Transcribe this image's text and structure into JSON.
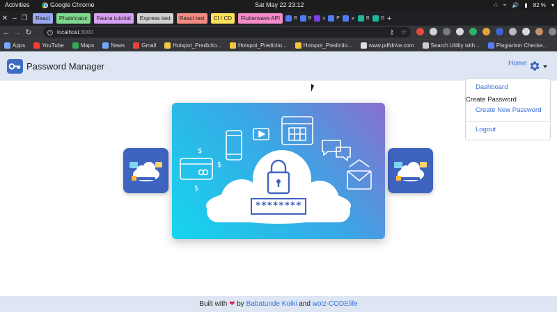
{
  "system_bar": {
    "activities": "Activities",
    "app_name": "Google Chrome",
    "clock": "Sat May 22  23:12",
    "battery": "82 %"
  },
  "tabs": [
    {
      "label": "React",
      "color": "#9aa7f0"
    },
    {
      "label": "Phabricator",
      "color": "#7fd88f"
    },
    {
      "label": "Fauna tutorial",
      "color": "#d8a0f0"
    },
    {
      "label": "Express test",
      "color": "#d0d0d0"
    },
    {
      "label": "React test",
      "color": "#f28b82"
    },
    {
      "label": "CI / CD",
      "color": "#fde15a"
    },
    {
      "label": "Flutterwave API",
      "color": "#f58ac8"
    }
  ],
  "address_bar": {
    "host": "localhost",
    "port": ":3000"
  },
  "bookmarks": [
    {
      "label": "Apps",
      "color": "#7aa7ff"
    },
    {
      "label": "YouTube",
      "color": "#ff3b30"
    },
    {
      "label": "Maps",
      "color": "#34a853"
    },
    {
      "label": "News",
      "color": "#6fa8ff"
    },
    {
      "label": "Gmail",
      "color": "#ea4335"
    },
    {
      "label": "Hotspot_Predictio...",
      "color": "#f4c542"
    },
    {
      "label": "Hotspot_Predictio...",
      "color": "#f4c542"
    },
    {
      "label": "Hotspot_Predictio...",
      "color": "#f4c542"
    },
    {
      "label": "www.pdfdrive.com",
      "color": "#e0e0e0"
    },
    {
      "label": "Search Utility with...",
      "color": "#cccccc"
    },
    {
      "label": "Plagiarism Checke...",
      "color": "#5b7cff"
    }
  ],
  "navbar": {
    "brand": "Password Manager",
    "home": "Home"
  },
  "dropdown": {
    "dashboard": "Dashboard",
    "header": "Create Password",
    "create_new": "Create New Password",
    "logout": "Logout"
  },
  "hero": {
    "password_mask": "********"
  },
  "footer": {
    "built_with": "Built with",
    "by": "by",
    "author": "Babatunde Koiki",
    "and": "and",
    "org": "wolz-CODElife"
  },
  "colors": {
    "accent": "#3a6fd8",
    "navbar_bg": "#dde6f2",
    "card_side": "#3e64c0",
    "heart": "#e0245e"
  }
}
